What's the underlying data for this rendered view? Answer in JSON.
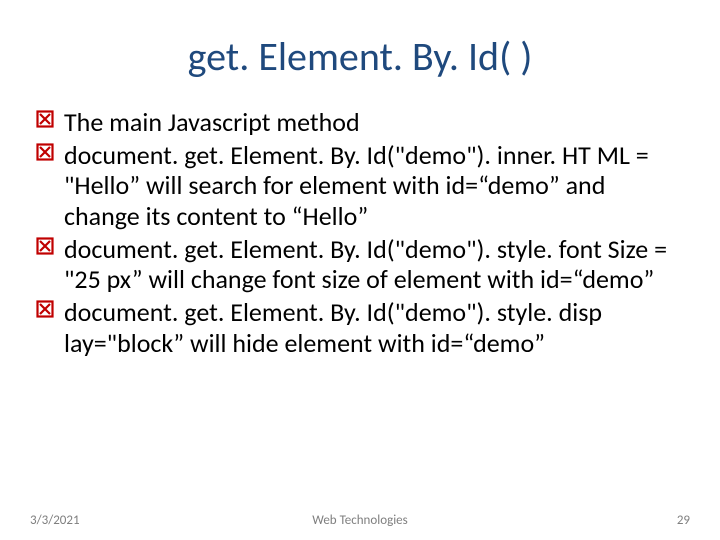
{
  "title": "get. Element. By. Id( )",
  "bullets": [
    "The main Javascript method",
    "document. get. Element. By. Id(\"demo\"). inner. HT ML = \"Hello” will search for element with id=“demo” and change its content to “Hello”",
    "document. get. Element. By. Id(\"demo\"). style. font Size = \"25 px” will change font size of element with id=“demo”",
    "document. get. Element. By. Id(\"demo\"). style. disp lay=\"block” will hide element with id=“demo”"
  ],
  "footer": {
    "date": "3/3/2021",
    "center": "Web Technologies",
    "page": "29"
  }
}
